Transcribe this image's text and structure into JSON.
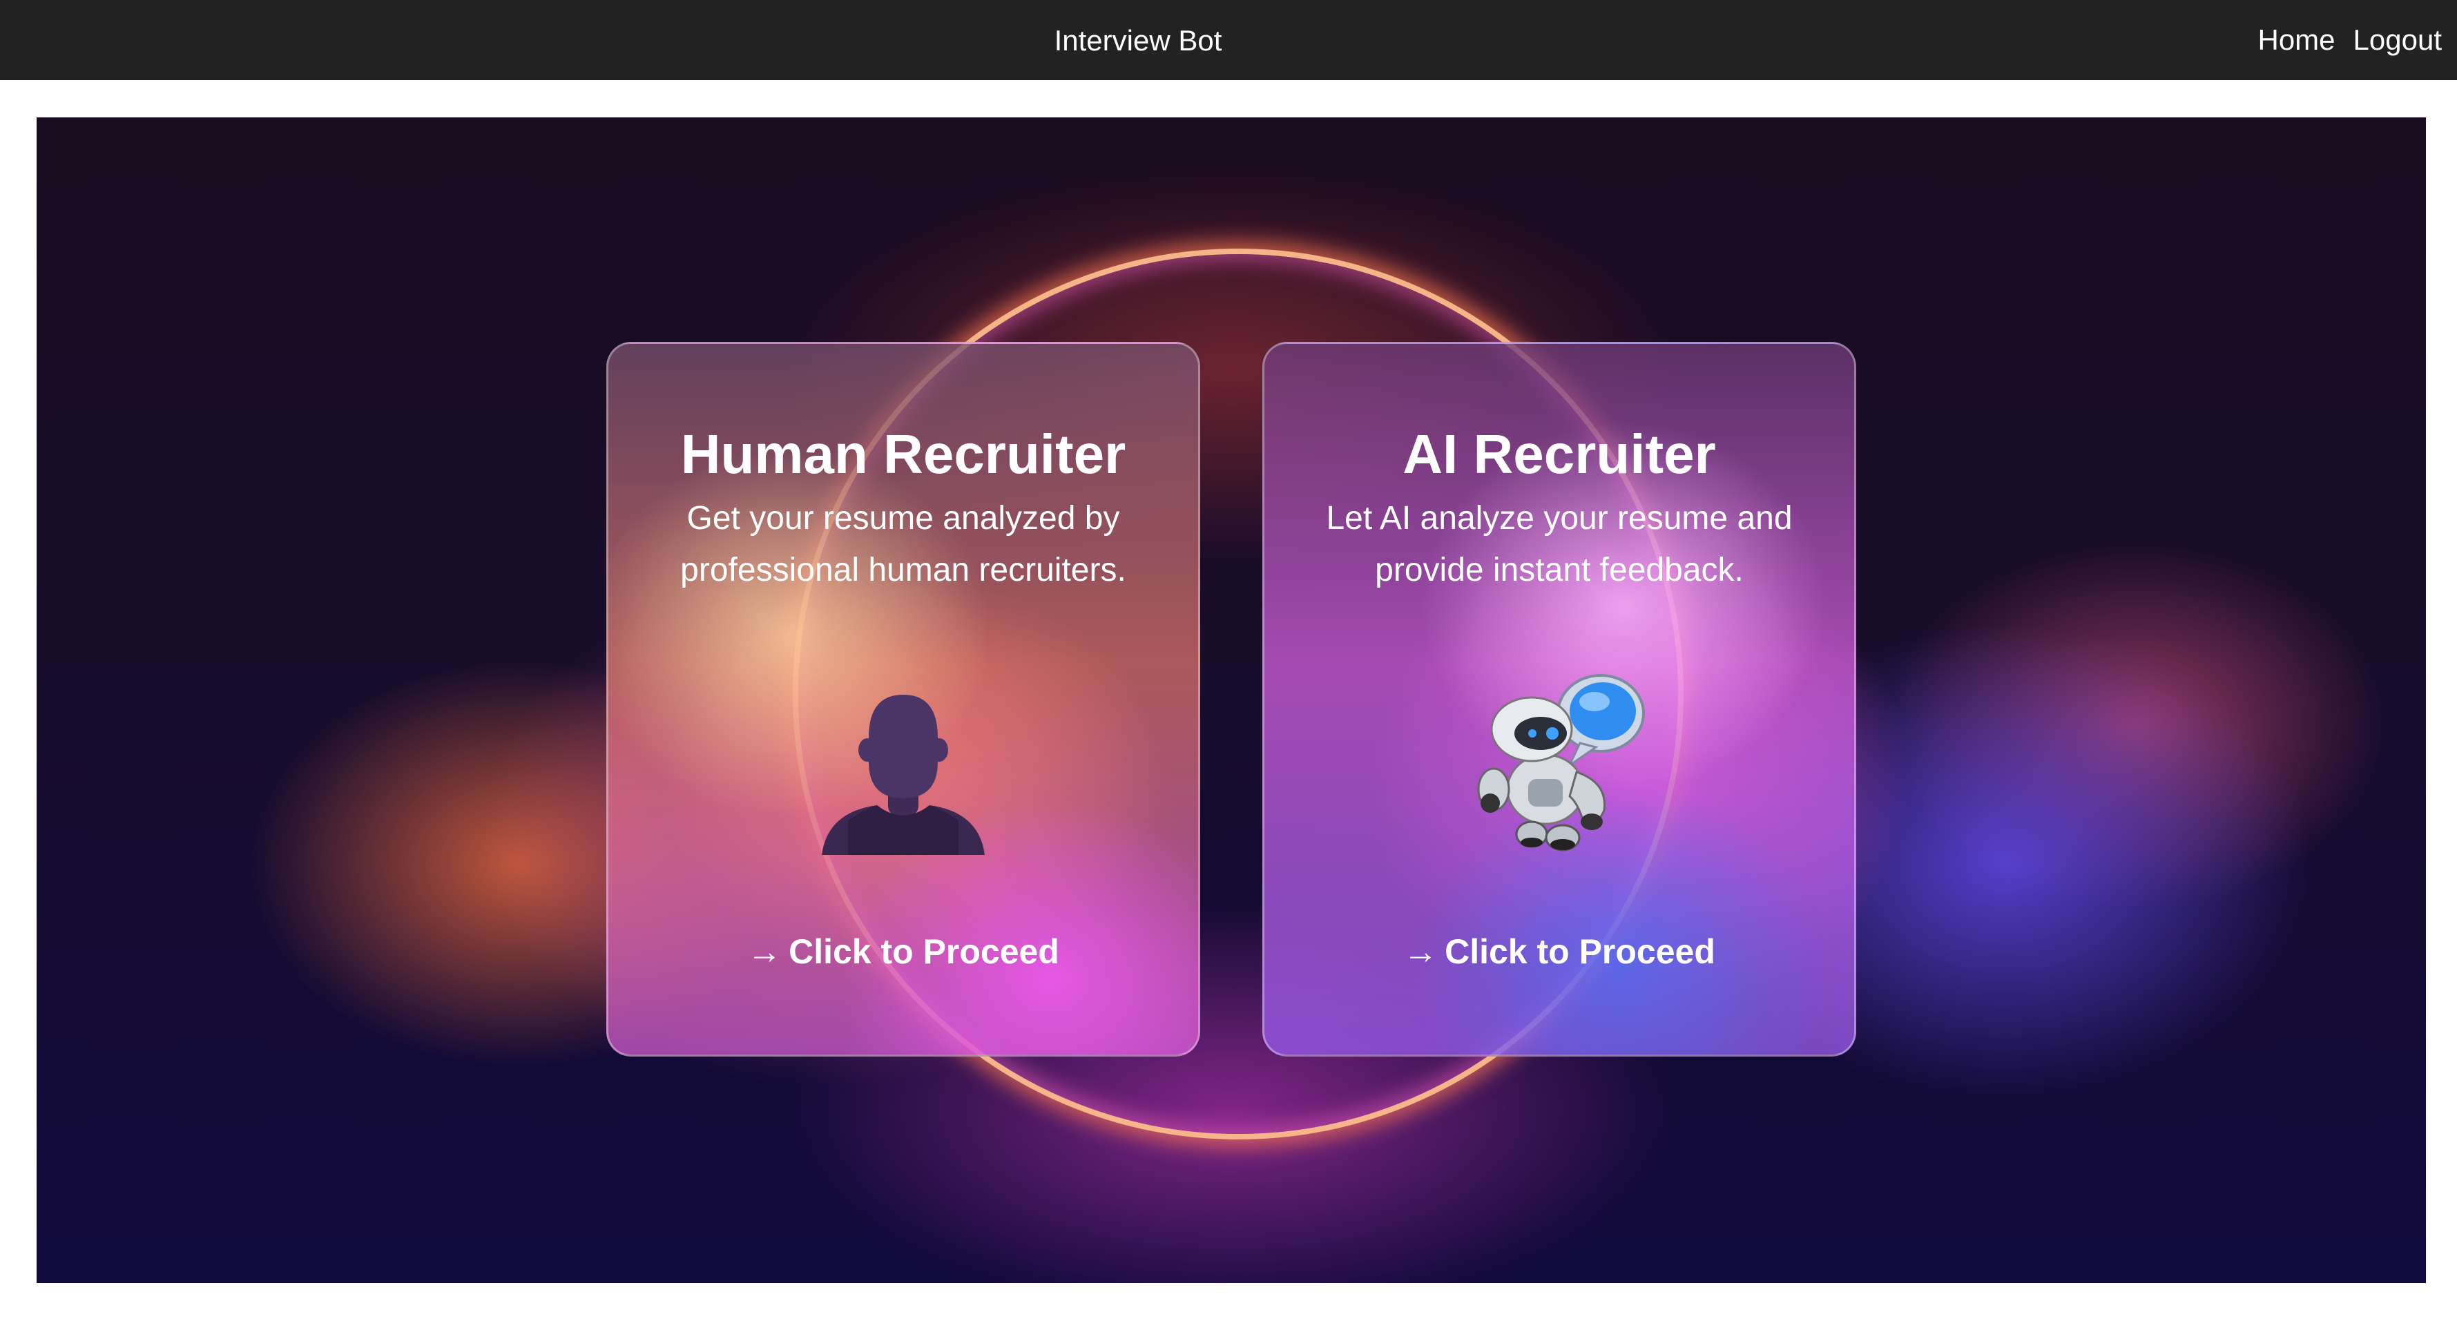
{
  "navbar": {
    "title": "Interview Bot",
    "links": [
      "Home",
      "Logout"
    ]
  },
  "cards": [
    {
      "title": "Human Recruiter",
      "description_lines": [
        "Get your resume analyzed by",
        "professional human recruiters."
      ],
      "icon": "person-silhouette-icon",
      "cta_arrow": "→",
      "cta": "Click to Proceed"
    },
    {
      "title": "AI Recruiter",
      "description_lines": [
        "Let AI analyze your resume and",
        "provide instant feedback."
      ],
      "icon": "robot-chat-icon",
      "cta_arrow": "→",
      "cta": "Click to Proceed"
    }
  ],
  "colors": {
    "navbar_bg": "#222222",
    "text": "#ffffff"
  }
}
